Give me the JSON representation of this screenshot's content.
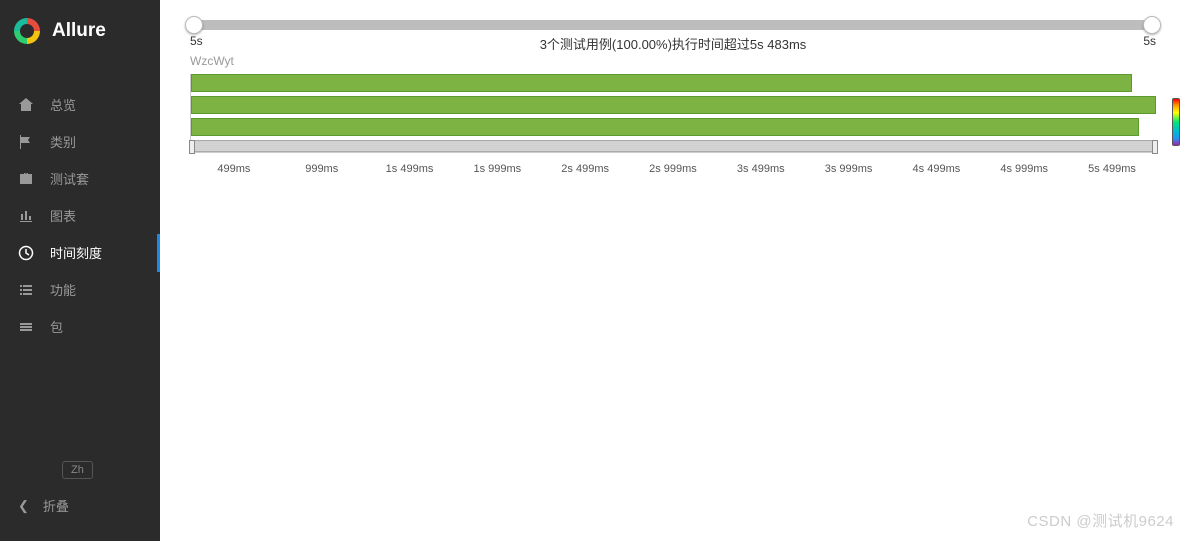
{
  "brand": "Allure",
  "sidebar": {
    "items": [
      {
        "label": "总览",
        "icon": "home-icon"
      },
      {
        "label": "类别",
        "icon": "flag-icon"
      },
      {
        "label": "测试套",
        "icon": "briefcase-icon"
      },
      {
        "label": "图表",
        "icon": "chart-icon"
      },
      {
        "label": "时间刻度",
        "icon": "clock-icon",
        "active": true
      },
      {
        "label": "功能",
        "icon": "list-icon"
      },
      {
        "label": "包",
        "icon": "layers-icon"
      }
    ],
    "lang": "Zh",
    "collapse": "折叠"
  },
  "slider": {
    "left": "5s",
    "right": "5s",
    "center": "3个测试用例(100.00%)执行时间超过5s 483ms"
  },
  "chart_data": {
    "type": "bar",
    "orientation": "horizontal",
    "series_label": "WzcWyt",
    "x_unit": "ms",
    "x_max_ms": 5718,
    "bars": [
      {
        "value_ms": 5575,
        "color": "#7cb342"
      },
      {
        "value_ms": 5718,
        "color": "#7cb342"
      },
      {
        "value_ms": 5615,
        "color": "#7cb342"
      }
    ],
    "ticks": [
      "499ms",
      "999ms",
      "1s 499ms",
      "1s 999ms",
      "2s 499ms",
      "2s 999ms",
      "3s 499ms",
      "3s 999ms",
      "4s 499ms",
      "4s 999ms",
      "5s 499ms"
    ]
  },
  "watermark": "CSDN @测试机9624"
}
